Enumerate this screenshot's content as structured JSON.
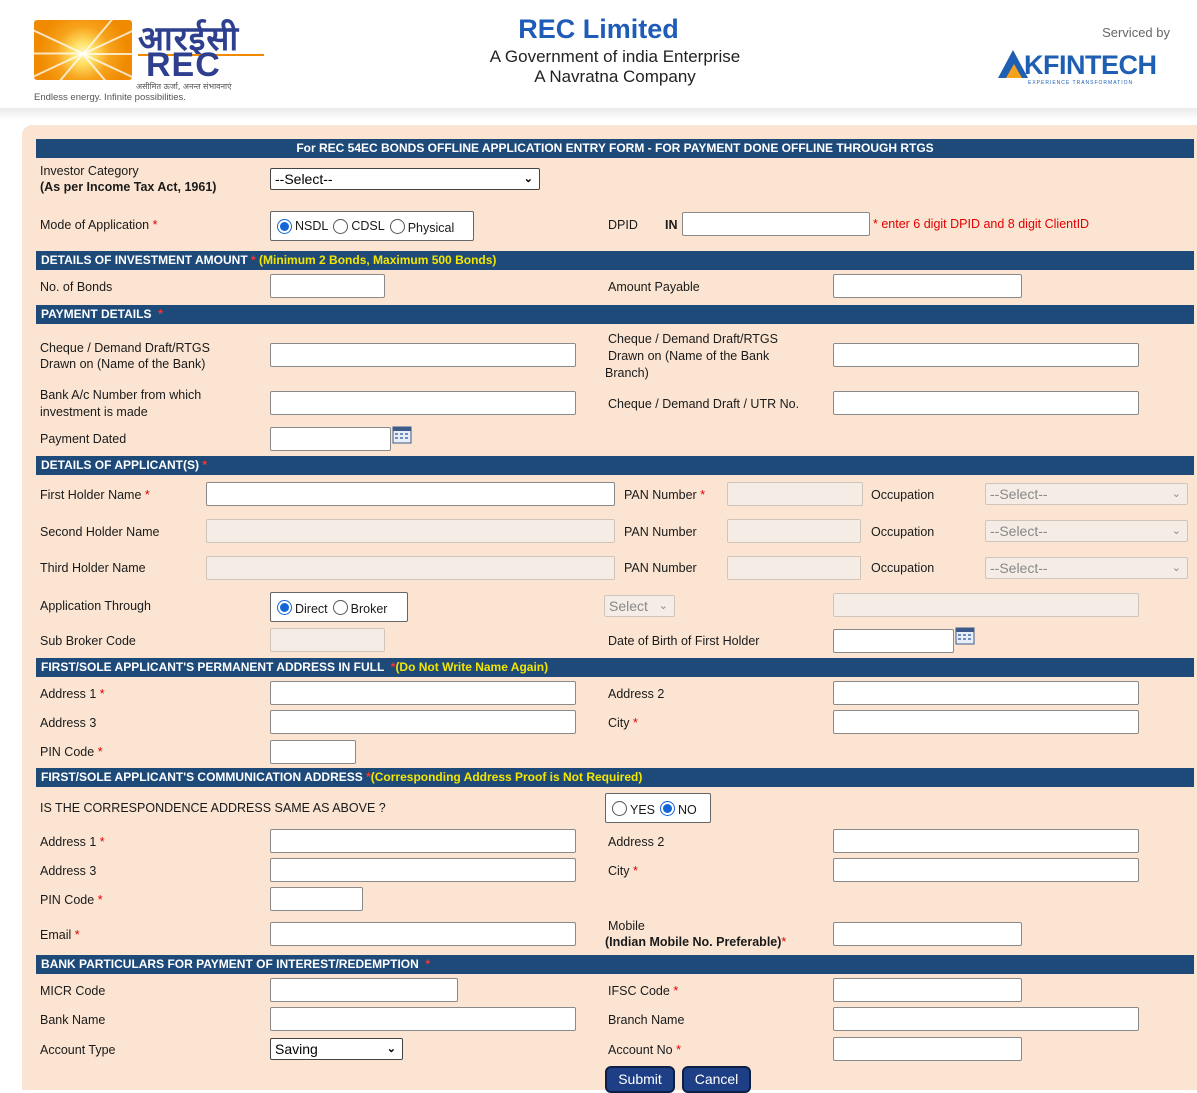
{
  "header": {
    "logo_hindi": "आरईसी",
    "logo_en": "REC",
    "logo_tagline_hindi": "असीमित ऊर्जा, अनन्त संभावनाएं",
    "logo_tagline_en": "Endless energy. Infinite possibilities.",
    "title": "REC Limited",
    "subtitle1": "A Government of india Enterprise",
    "subtitle2": "A Navratna Company",
    "serviced_by": "Serviced by",
    "partner_logo": "KFINTECH",
    "partner_tagline": "EXPERIENCE TRANSFORMATION"
  },
  "form": {
    "title": "For REC 54EC BONDS OFFLINE APPLICATION ENTRY FORM - FOR PAYMENT DONE OFFLINE THROUGH RTGS",
    "investor_category_label": "Investor Category",
    "investor_category_sub": "(As per Income Tax Act, 1961)",
    "investor_category_value": "--Select--",
    "mode_label": "Mode of Application",
    "mode_options": [
      "NSDL",
      "CDSL",
      "Physical"
    ],
    "dpid_label": "DPID",
    "dpid_prefix": "IN",
    "dpid_hint": "* enter 6 digit DPID and 8 digit ClientID",
    "required_mark": "*",
    "investment": {
      "header": "DETAILS OF INVESTMENT AMOUNT",
      "note": "(Minimum 2 Bonds, Maximum 500 Bonds)",
      "bonds_label": "No. of Bonds",
      "amount_label": "Amount Payable"
    },
    "payment": {
      "header": "PAYMENT DETAILS",
      "drawn_bank_label_1": "Cheque / Demand Draft/RTGS",
      "drawn_bank_label_2": "Drawn on (Name of the Bank)",
      "drawn_branch_label_1": "Cheque / Demand Draft/RTGS",
      "drawn_branch_label_2": "Drawn on (Name of the Bank",
      "drawn_branch_label_3": "Branch)",
      "account_label_1": "Bank A/c Number from which",
      "account_label_2": "investment is made",
      "utr_label": "Cheque / Demand Draft / UTR No.",
      "dated_label": "Payment Dated"
    },
    "applicants": {
      "header": "DETAILS OF APPLICANT(S)",
      "first_holder_label": "First Holder Name",
      "second_holder_label": "Second Holder Name",
      "third_holder_label": "Third Holder Name",
      "pan_label": "PAN Number",
      "occupation_label": "Occupation",
      "occupation_value": "--Select--",
      "through_label": "Application Through",
      "through_options": [
        "Direct",
        "Broker"
      ],
      "broker_select": "Select",
      "sub_broker_label": "Sub Broker Code",
      "dob_label": "Date of Birth of First Holder"
    },
    "permanent": {
      "header": "FIRST/SOLE APPLICANT'S PERMANENT ADDRESS IN FULL",
      "note": "(Do Not Write Name Again)",
      "address1_label": "Address 1",
      "address2_label": "Address 2",
      "address3_label": "Address 3",
      "city_label": "City",
      "pin_label": "PIN Code"
    },
    "communication": {
      "header": "FIRST/SOLE APPLICANT'S COMMUNICATION ADDRESS",
      "note": "(Corresponding Address Proof is Not Required)",
      "same_question": "IS THE CORRESPONDENCE ADDRESS SAME AS ABOVE ?",
      "same_options": [
        "YES",
        "NO"
      ],
      "address1_label": "Address 1",
      "address2_label": "Address 2",
      "address3_label": "Address 3",
      "city_label": "City",
      "pin_label": "PIN Code",
      "email_label": "Email",
      "mobile_label": "Mobile",
      "mobile_sub": "(Indian Mobile No. Preferable)"
    },
    "bank": {
      "header": "BANK PARTICULARS FOR PAYMENT OF INTEREST/REDEMPTION",
      "micr_label": "MICR Code",
      "ifsc_label": "IFSC Code",
      "bank_name_label": "Bank Name",
      "branch_label": "Branch Name",
      "account_type_label": "Account Type",
      "account_type_value": "Saving",
      "account_no_label": "Account No"
    },
    "submit_label": "Submit",
    "cancel_label": "Cancel"
  },
  "colors": {
    "section_header_bg": "#1d4a79",
    "form_bg": "#fbe5d2",
    "required": "#e00000",
    "note_yellow": "#f4e600",
    "title_blue": "#1f5cb8",
    "button_bg": "#1e3f86"
  },
  "icons": {
    "calendar": "calendar-icon",
    "dropdown": "chevron-down-icon"
  }
}
